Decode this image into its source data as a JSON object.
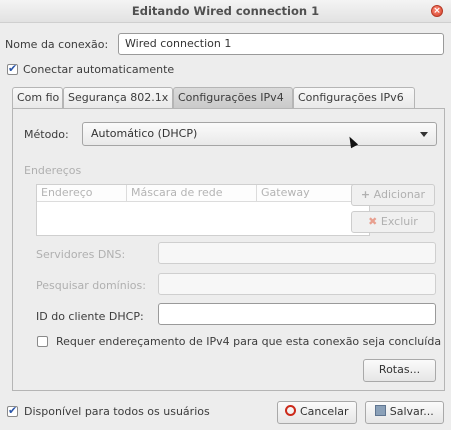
{
  "window": {
    "title": "Editando Wired connection 1"
  },
  "connection": {
    "name_label": "Nome da conexão:",
    "name_value": "Wired connection 1"
  },
  "auto_connect": {
    "label": "Conectar automaticamente",
    "checked": true
  },
  "tabs": [
    {
      "label": "Com fio",
      "active": false
    },
    {
      "label": "Segurança 802.1x",
      "active": false
    },
    {
      "label": "Configurações IPv4",
      "active": true
    },
    {
      "label": "Configurações IPv6",
      "active": false
    }
  ],
  "method": {
    "label": "Método:",
    "value": "Automático (DHCP)"
  },
  "addresses": {
    "heading": "Endereços",
    "columns": [
      "Endereço",
      "Máscara de rede",
      "Gateway"
    ],
    "add_label": "Adicionar",
    "delete_label": "Excluir"
  },
  "dns": {
    "label": "Servidores DNS:",
    "value": ""
  },
  "search_domains": {
    "label": "Pesquisar domínios:",
    "value": ""
  },
  "dhcp_client_id": {
    "label": "ID do cliente DHCP:",
    "value": ""
  },
  "require_ipv4": {
    "label": "Requer endereçamento de IPv4 para que esta conexão seja concluída",
    "checked": false
  },
  "routes_label": "Rotas...",
  "all_users": {
    "label": "Disponível para todos os usuários",
    "checked": true
  },
  "footer": {
    "cancel_label": "Cancelar",
    "save_label": "Salvar..."
  },
  "icons": {
    "close": "close-icon",
    "add": "plus-icon",
    "delete": "x-icon",
    "cancel": "stop-icon",
    "save": "save-icon"
  },
  "colors": {
    "delete_icon": "#e24a2c",
    "cancel_icon": "#cc2a1a",
    "check": "#2a55a8"
  }
}
